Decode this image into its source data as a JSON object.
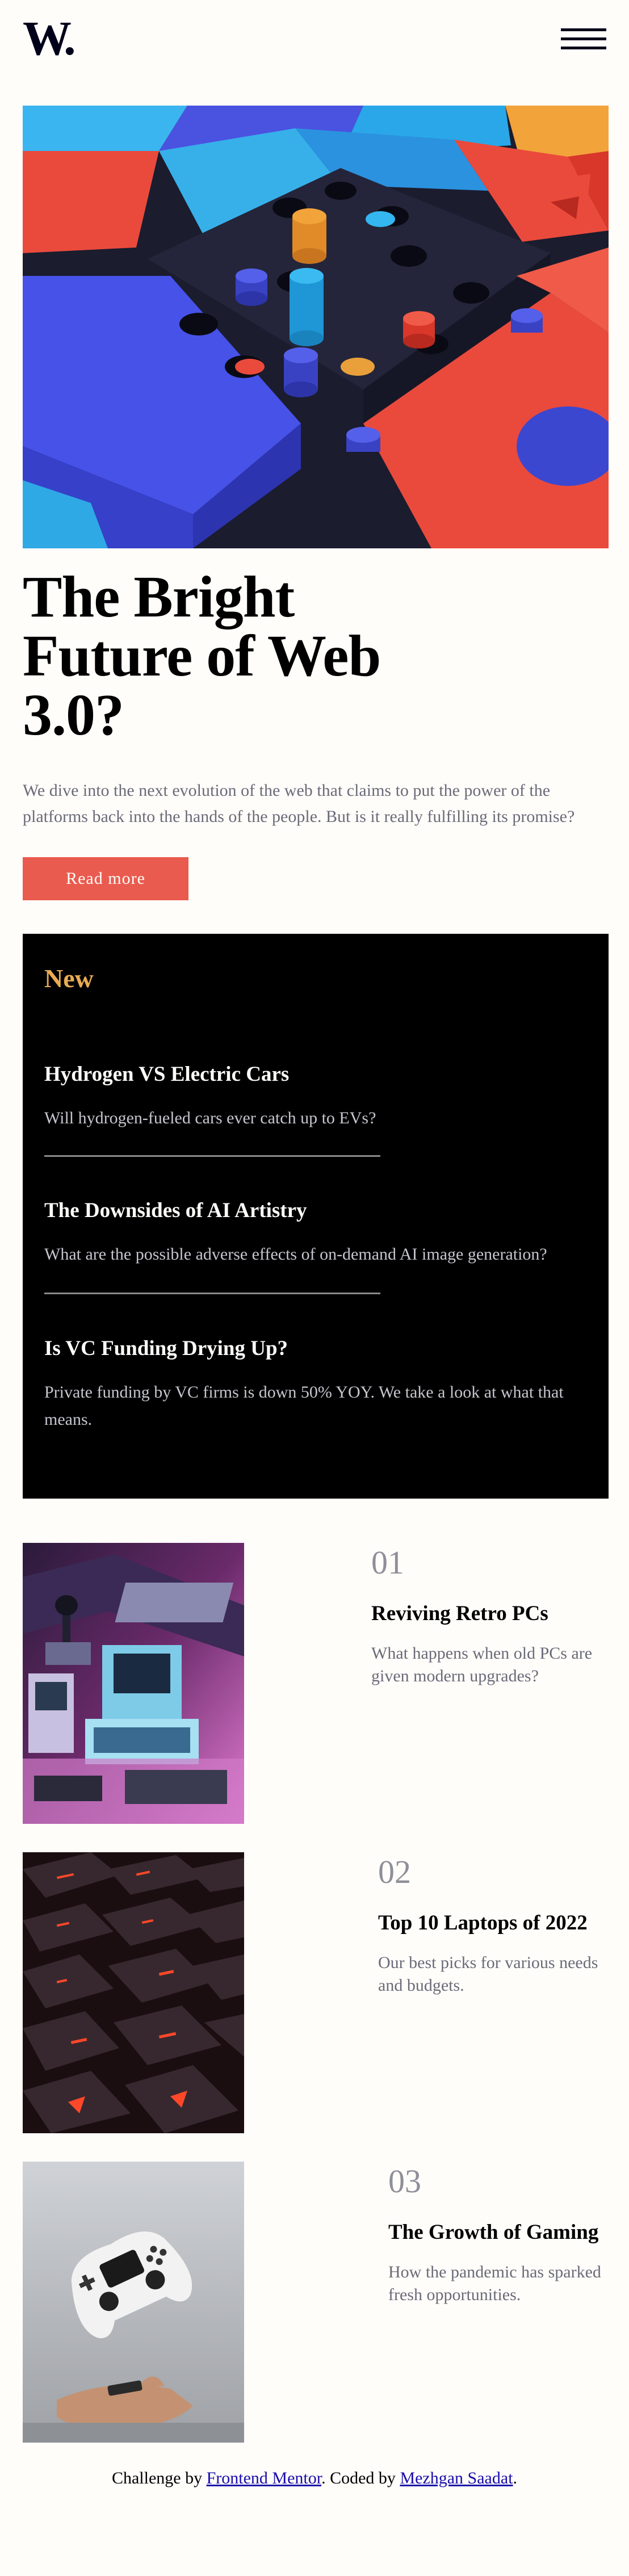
{
  "header": {
    "logo_text": "W.",
    "menu_icon": "hamburger-menu-icon"
  },
  "hero": {
    "image_desc": "3d-colorful-blocks-illustration",
    "title_line1": "The Bright",
    "title_line2": "Future of Web",
    "title_line3": "3.0?",
    "description": "We dive into the next evolution of the web that claims to put the power of the platforms back into the hands of the people. But is it really fulfilling its promise?",
    "button_label": "Read more"
  },
  "new_section": {
    "heading": "New",
    "items": [
      {
        "title": "Hydrogen VS Electric Cars",
        "description": "Will hydrogen-fueled cars ever catch up to EVs?"
      },
      {
        "title": "The Downsides of AI Artistry",
        "description": "What are the possible adverse effects of on-demand AI image generation?"
      },
      {
        "title": "Is VC Funding Drying Up?",
        "description": "Private funding by VC firms is down 50% YOY. We take a look at what that means."
      }
    ]
  },
  "cards": [
    {
      "number": "01",
      "title": "Reviving Retro PCs",
      "description": "What happens when old PCs are given modern upgrades?"
    },
    {
      "number": "02",
      "title": "Top 10 Laptops of 2022",
      "description": "Our best picks for various needs and budgets."
    },
    {
      "number": "03",
      "title": "The Growth of Gaming",
      "description": "How the pandemic has sparked fresh opportunities."
    }
  ],
  "footer": {
    "prefix": "Challenge by ",
    "frontend_mentor": "Frontend Mentor",
    "middle": ". Coded by ",
    "author": "Mezhgan Saadat",
    "suffix": "."
  },
  "colors": {
    "background": "#fffdfa",
    "accent_red": "#ea5b4f",
    "accent_gold": "#e9ab53",
    "dark": "#000000",
    "grey_text": "#6b6b78"
  }
}
